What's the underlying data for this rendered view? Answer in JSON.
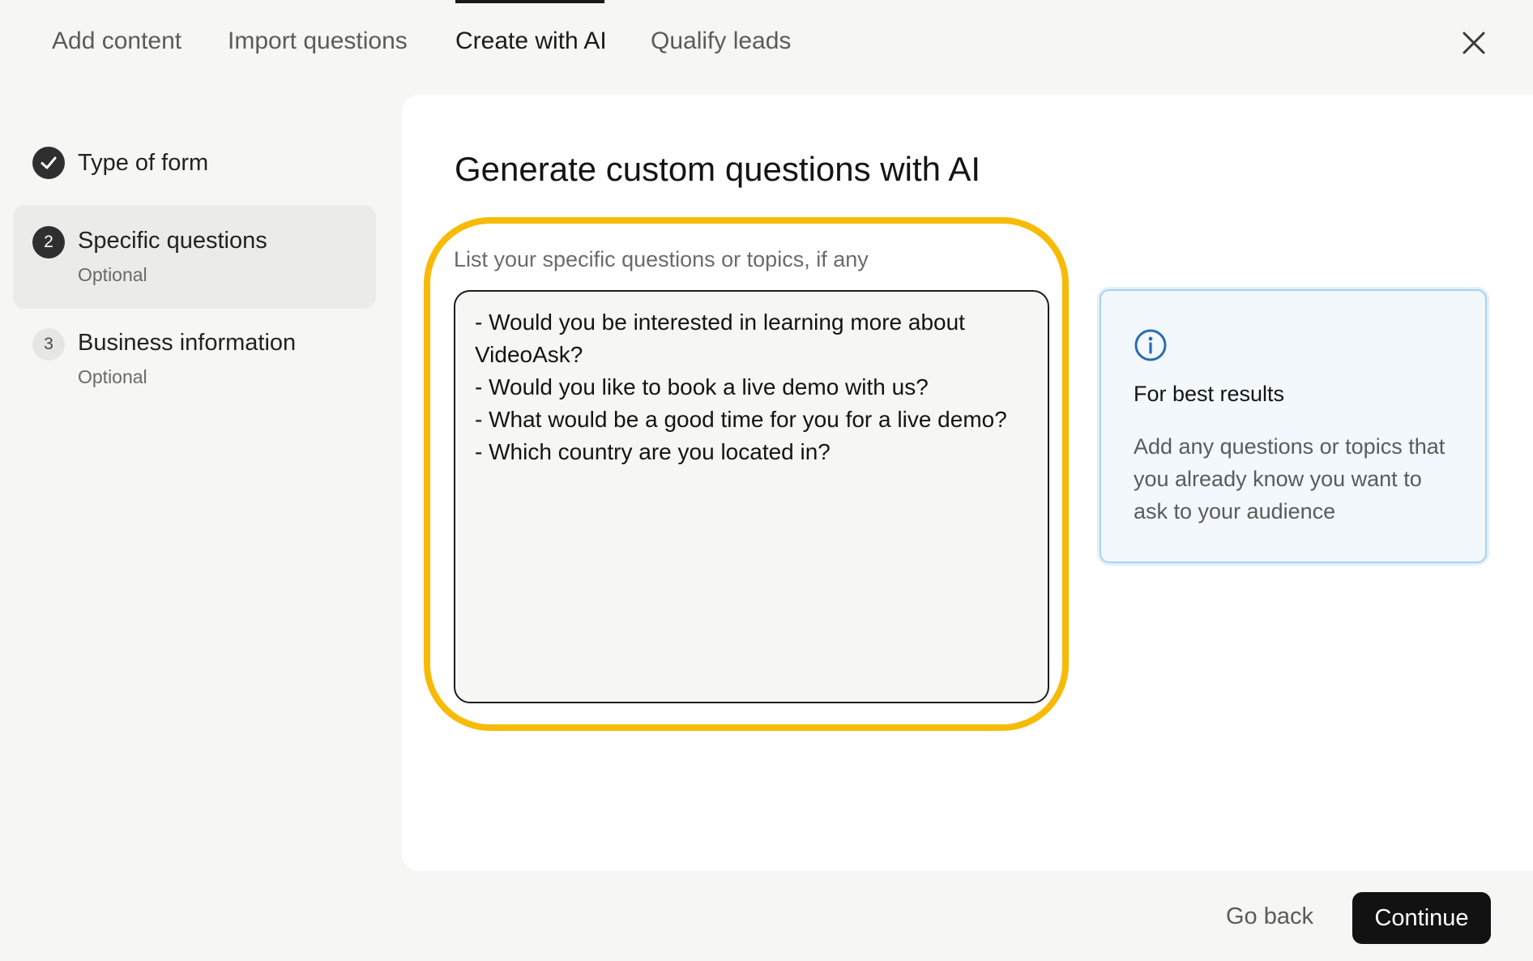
{
  "tabs": [
    {
      "label": "Add content",
      "active": false
    },
    {
      "label": "Import questions",
      "active": false
    },
    {
      "label": "Create with AI",
      "active": true
    },
    {
      "label": "Qualify leads",
      "active": false
    }
  ],
  "close_icon": "close-icon",
  "stepper": {
    "steps": [
      {
        "marker": "",
        "marker_icon": "check-icon",
        "state": "done",
        "title": "Type of form",
        "subtitle": ""
      },
      {
        "marker": "2",
        "state": "current",
        "title": "Specific questions",
        "subtitle": "Optional"
      },
      {
        "marker": "3",
        "state": "pending",
        "title": "Business information",
        "subtitle": "Optional"
      }
    ]
  },
  "main": {
    "title": "Generate custom questions with AI",
    "field_label": "List your specific questions or topics, if any",
    "field_value": "- Would you be interested in learning more about VideoAsk?\n- Would you like to book a live demo with us?\n- What would be a good time for you for a live demo?\n- Which country are you located in?",
    "highlight_color": "#f7bb07"
  },
  "tip": {
    "icon": "info-icon",
    "title": "For best results",
    "body": "Add any questions or topics that you already know you want to ask to your audience",
    "accent": "#2b6cb0"
  },
  "footer": {
    "back_label": "Go back",
    "continue_label": "Continue"
  }
}
